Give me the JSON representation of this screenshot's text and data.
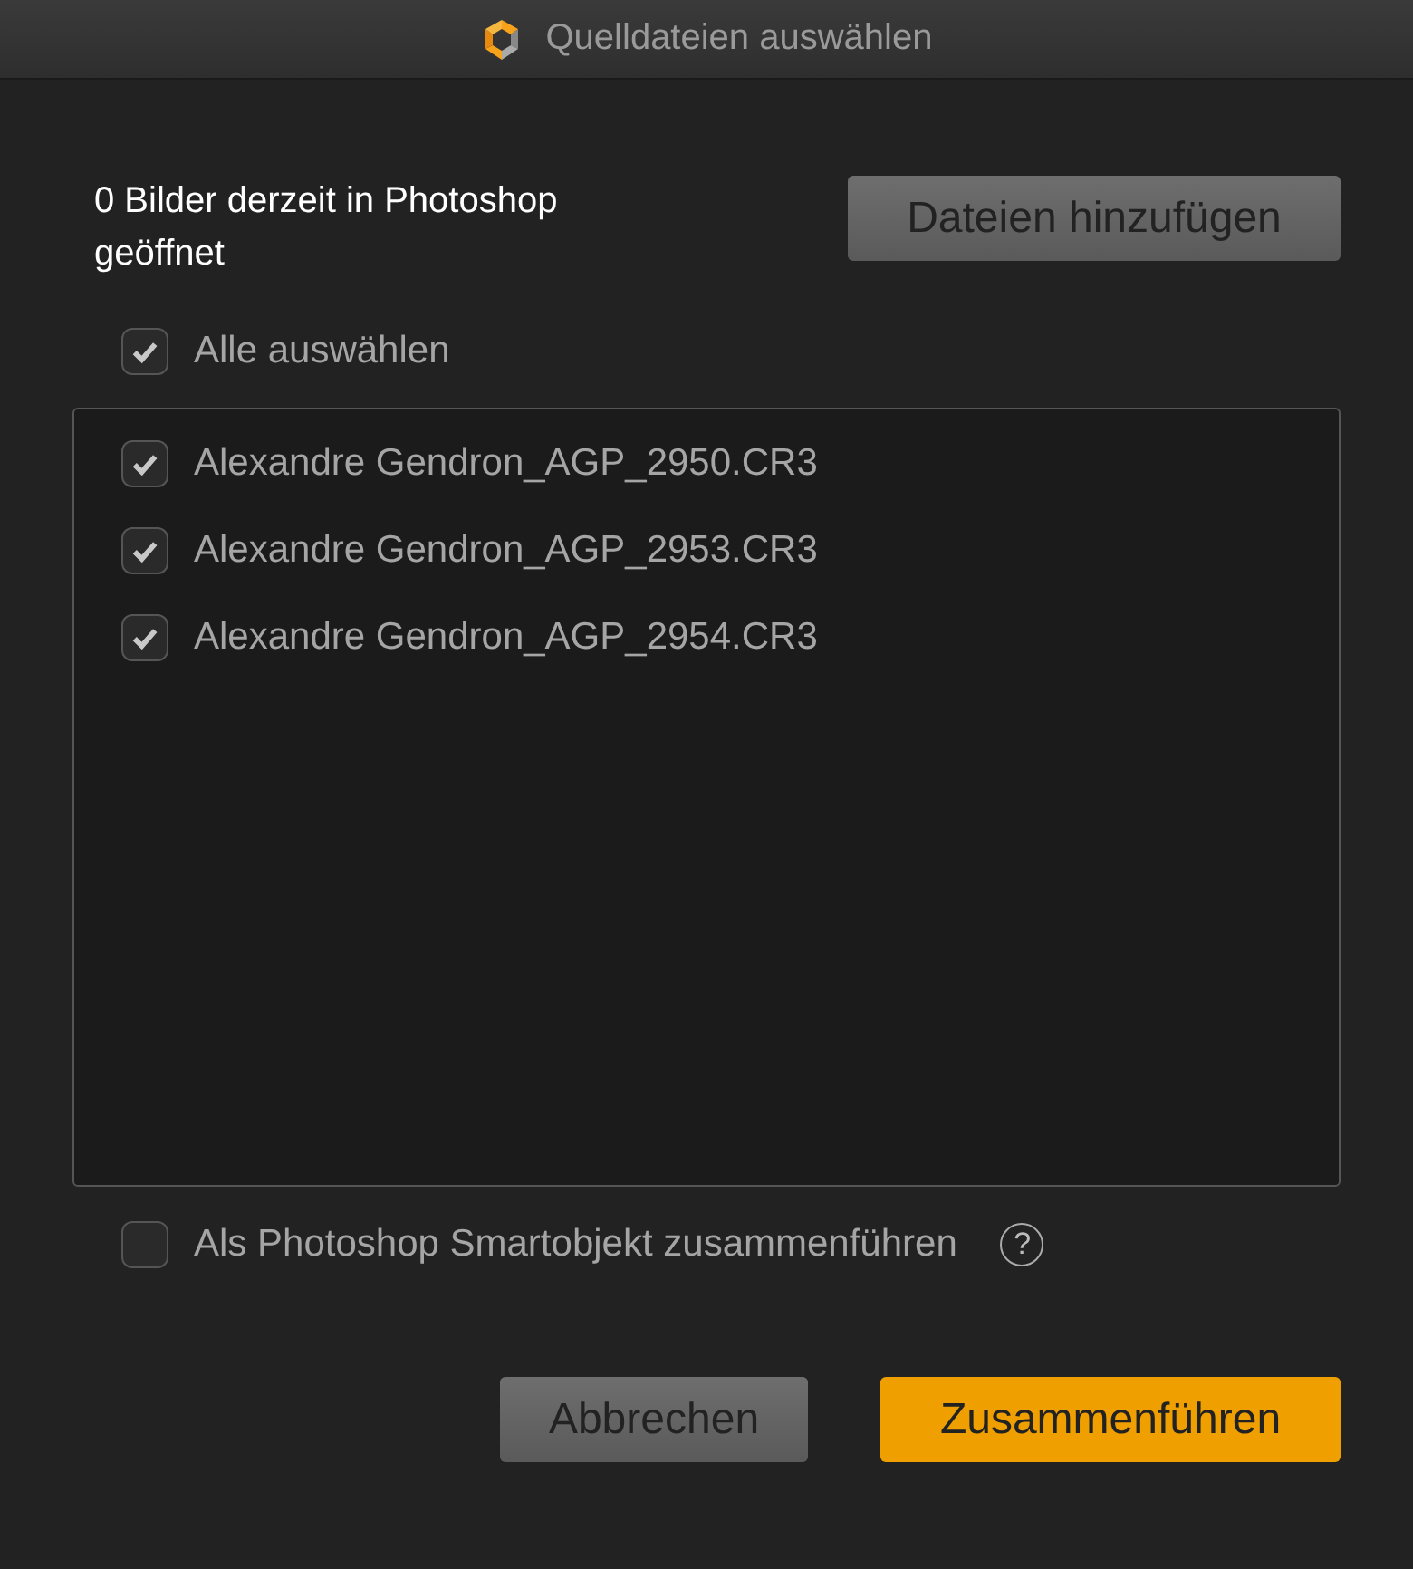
{
  "window": {
    "title": "Quelldateien auswählen"
  },
  "info": "0 Bilder derzeit in Photoshop geöffnet",
  "add_button": "Dateien hinzufügen",
  "select_all": {
    "label": "Alle auswählen",
    "checked": true
  },
  "files": [
    {
      "label": "Alexandre Gendron_AGP_2950.CR3",
      "checked": true
    },
    {
      "label": "Alexandre Gendron_AGP_2953.CR3",
      "checked": true
    },
    {
      "label": "Alexandre Gendron_AGP_2954.CR3",
      "checked": true
    }
  ],
  "smart_object": {
    "label": "Als Photoshop Smartobjekt zusammenführen",
    "checked": false,
    "help": "?"
  },
  "buttons": [
    {
      "label": "Abbrechen",
      "kind": "secondary"
    },
    {
      "label": "Zusammenführen",
      "kind": "primary"
    }
  ]
}
